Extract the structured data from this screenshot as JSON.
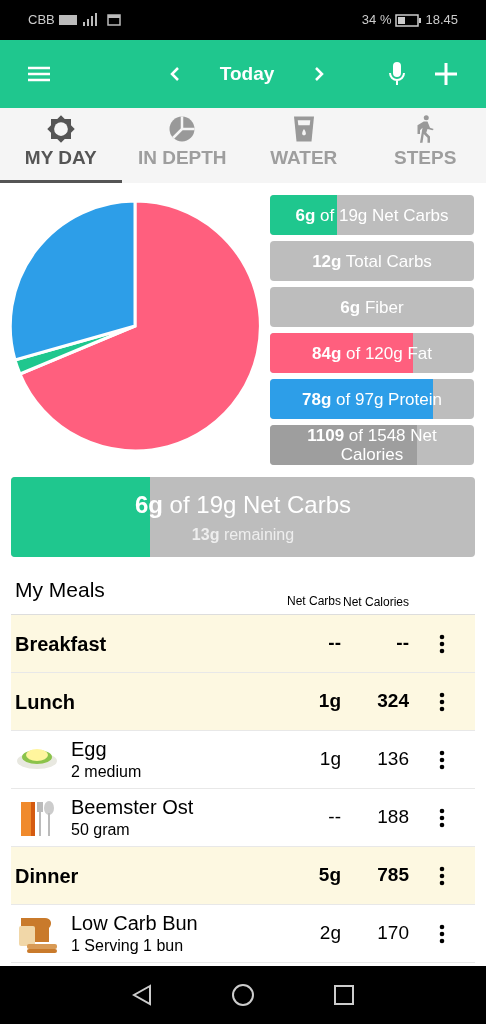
{
  "status_bar": {
    "carrier": "CBB",
    "battery": "34 %",
    "time": "18.45"
  },
  "app_bar": {
    "title": "Today"
  },
  "tabs": [
    {
      "label": "MY DAY",
      "selected": true,
      "kind": "sun"
    },
    {
      "label": "IN DEPTH",
      "selected": false,
      "kind": "pie"
    },
    {
      "label": "WATER",
      "selected": false,
      "kind": "glass"
    },
    {
      "label": "STEPS",
      "selected": false,
      "kind": "walk"
    }
  ],
  "macros": [
    {
      "text": "**6g** of 19g Net Carbs",
      "level": 0.33,
      "color": "#1fc78e"
    },
    {
      "text": "**12g** Total Carbs"
    },
    {
      "text": "**6g** Fiber"
    },
    {
      "text": "**84g** of 120g Fat",
      "level": 0.7,
      "color": "#ff5f7e"
    },
    {
      "text": "**78g** of 97g Protein",
      "level": 0.8,
      "color": "#2d9ee8"
    },
    {
      "text": "**1109** of 1548 Net Calories",
      "level": 0.72,
      "color": "#9e9e9e"
    }
  ],
  "goal": {
    "text": "**6g** of 19g Net Carbs",
    "sub": "**13g** remaining",
    "level": 0.3
  },
  "meals": {
    "title": "My Meals",
    "columns": [
      "Net Carbs",
      "Net Calories"
    ],
    "rows": [
      {
        "kind": "meal",
        "name": "Breakfast",
        "carbs": "--",
        "calories": "--"
      },
      {
        "kind": "meal",
        "name": "Lunch",
        "carbs": "1g",
        "calories": "324"
      },
      {
        "kind": "egg",
        "name": "Egg",
        "amount": "2 medium",
        "carbs": "1g",
        "calories": "136"
      },
      {
        "kind": "cutlery",
        "name": "Beemster Ost",
        "amount": "50 gram",
        "carbs": "--",
        "calories": "188"
      },
      {
        "kind": "meal",
        "name": "Dinner",
        "carbs": "5g",
        "calories": "785"
      },
      {
        "kind": "bread",
        "name": "Low Carb Bun",
        "amount": "1 Serving 1 bun",
        "carbs": "2g",
        "calories": "170"
      }
    ]
  }
}
